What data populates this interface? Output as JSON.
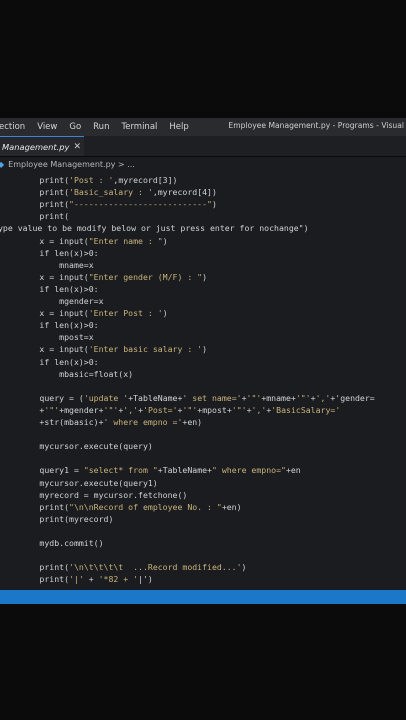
{
  "menubar": {
    "items": [
      "ection",
      "View",
      "Go",
      "Run",
      "Terminal",
      "Help"
    ],
    "window_title": "Employee Management.py - Programs - Visual"
  },
  "tab": {
    "label": "Management.py",
    "close_glyph": "✕"
  },
  "breadcrumb": {
    "text": "Employee Management.py > ..."
  },
  "code": {
    "lines": [
      "        print('Post : ',myrecord[3])",
      "        print('Basic_salary : ',myrecord[4])",
      "        print(\"---------------------------\")",
      "        print(",
      "ype value to be modify below or just press enter for nochange\")",
      "        x = input(\"Enter name : \")",
      "        if len(x)>0:",
      "            mname=x",
      "        x = input(\"Enter gender (M/F) : \")",
      "        if len(x)>0:",
      "            mgender=x",
      "        x = input('Enter Post : ')",
      "        if len(x)>0:",
      "            mpost=x",
      "        x = input('Enter basic salary : ')",
      "        if len(x)>0:",
      "            mbasic=float(x)",
      "",
      "        query = ('update '+TableName+' set name='+'\"'+mname+'\"'+','+'gender=",
      "        +'\"'+mgender+'\"'+','+'Post='+'\"'+mpost+'\"'+','+'BasicSalary='",
      "        +str(mbasic)+' where empno ='+en)",
      "",
      "        mycursor.execute(query)",
      "",
      "        query1 = \"select* from \"+TableName+\" where empno=\"+en",
      "        mycursor.execute(query1)",
      "        myrecord = mycursor.fetchone()",
      "        print(\"\\n\\nRecord of employee No. : \"+en)",
      "        print(myrecord)",
      "",
      "        mydb.commit()",
      "",
      "        print('\\n\\t\\t\\t\\t  ...Record modified...')",
      "        print('|' + '*82 + '|')"
    ]
  }
}
